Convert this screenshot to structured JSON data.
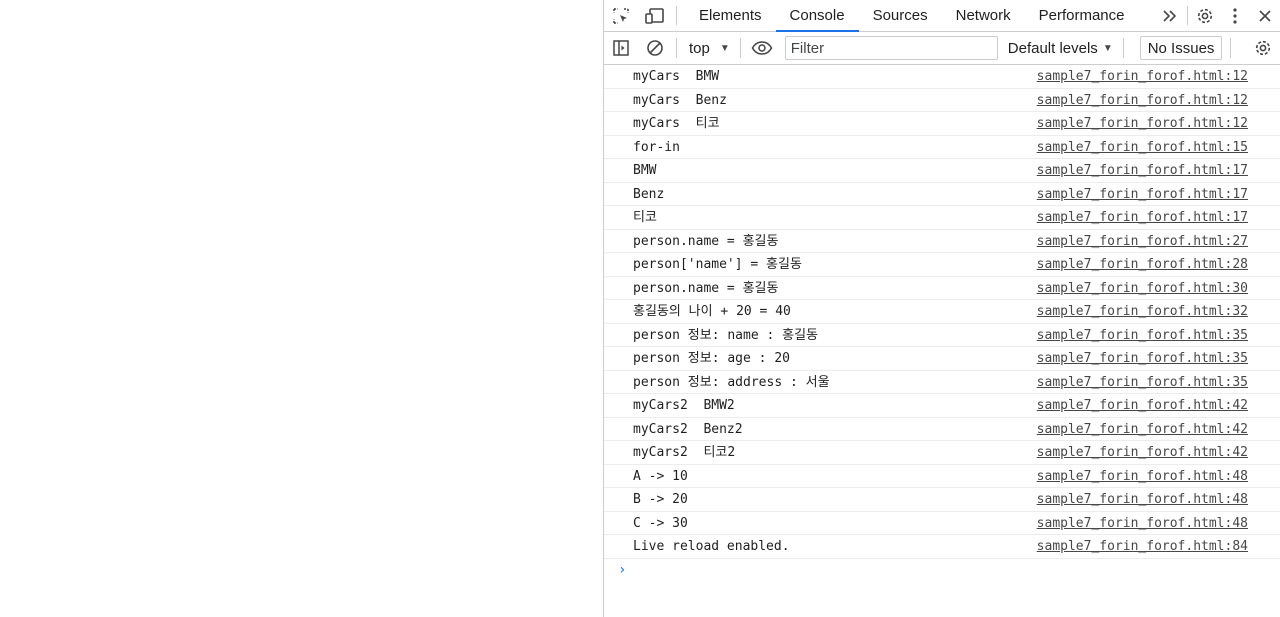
{
  "tabs": [
    {
      "label": "Elements"
    },
    {
      "label": "Console"
    },
    {
      "label": "Sources"
    },
    {
      "label": "Network"
    },
    {
      "label": "Performance"
    }
  ],
  "icons": {
    "inspect": "inspect-element-icon",
    "device": "device-toolbar-icon",
    "more_tabs": "chevron-double-right-icon",
    "settings": "gear-icon",
    "menu": "kebab-menu-icon",
    "close": "close-icon",
    "sidebar": "sidebar-toggle-icon",
    "clear": "clear-console-icon",
    "eye": "eye-icon"
  },
  "toolbar": {
    "context": "top",
    "filter_placeholder": "Filter",
    "levels": "Default levels",
    "issues": "No Issues"
  },
  "logs": [
    {
      "msg": "myCars  BMW",
      "src": "sample7_forin_forof.html:12"
    },
    {
      "msg": "myCars  Benz",
      "src": "sample7_forin_forof.html:12"
    },
    {
      "msg": "myCars  티코",
      "src": "sample7_forin_forof.html:12"
    },
    {
      "msg": "for-in",
      "src": "sample7_forin_forof.html:15"
    },
    {
      "msg": "BMW",
      "src": "sample7_forin_forof.html:17"
    },
    {
      "msg": "Benz",
      "src": "sample7_forin_forof.html:17"
    },
    {
      "msg": "티코",
      "src": "sample7_forin_forof.html:17"
    },
    {
      "msg": "person.name = 홍길동",
      "src": "sample7_forin_forof.html:27"
    },
    {
      "msg": "person['name'] = 홍길동",
      "src": "sample7_forin_forof.html:28"
    },
    {
      "msg": "person.name = 홍길동",
      "src": "sample7_forin_forof.html:30"
    },
    {
      "msg": "홍길동의 나이 + 20 = 40",
      "src": "sample7_forin_forof.html:32"
    },
    {
      "msg": "person 정보: name : 홍길동",
      "src": "sample7_forin_forof.html:35"
    },
    {
      "msg": "person 정보: age : 20",
      "src": "sample7_forin_forof.html:35"
    },
    {
      "msg": "person 정보: address : 서울",
      "src": "sample7_forin_forof.html:35"
    },
    {
      "msg": "myCars2  BMW2",
      "src": "sample7_forin_forof.html:42"
    },
    {
      "msg": "myCars2  Benz2",
      "src": "sample7_forin_forof.html:42"
    },
    {
      "msg": "myCars2  티코2",
      "src": "sample7_forin_forof.html:42"
    },
    {
      "msg": "A -> 10",
      "src": "sample7_forin_forof.html:48"
    },
    {
      "msg": "B -> 20",
      "src": "sample7_forin_forof.html:48"
    },
    {
      "msg": "C -> 30",
      "src": "sample7_forin_forof.html:48"
    },
    {
      "msg": "Live reload enabled.",
      "src": "sample7_forin_forof.html:84"
    }
  ],
  "prompt": "›",
  "colors": {
    "accent": "#1a73e8",
    "border": "#cbcdd1"
  }
}
